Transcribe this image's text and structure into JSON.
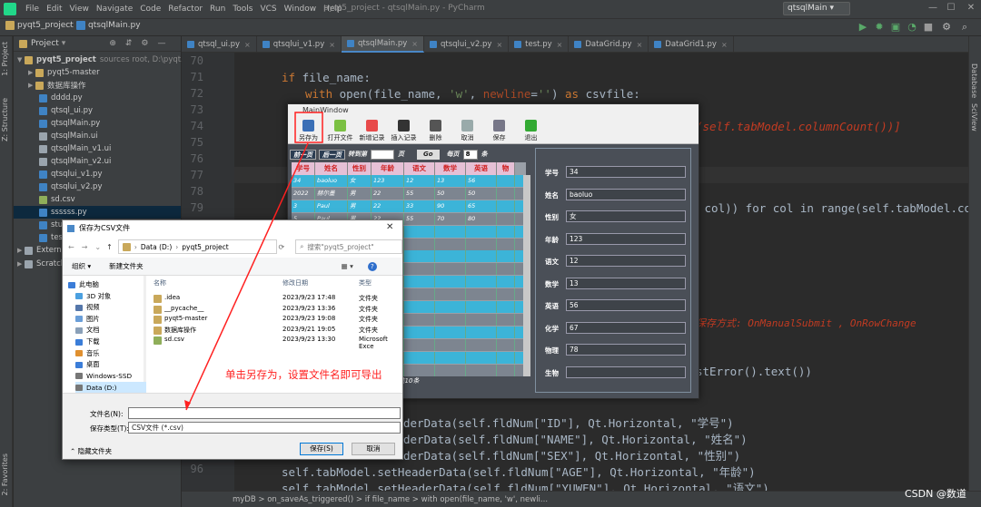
{
  "menu": {
    "project_name": "pyqt5_project",
    "file_name": "qtsqlMain.py",
    "items": [
      "File",
      "Edit",
      "View",
      "Navigate",
      "Code",
      "Refactor",
      "Run",
      "Tools",
      "VCS",
      "Window",
      "Help"
    ],
    "title": "pyqt5_project - qtsqlMain.py - PyCharm"
  },
  "toolbar": {
    "run_config": "qtsqlMain"
  },
  "left_strip": {
    "project": "1: Project",
    "structure": "Z: Structure",
    "favorites": "2: Favorites"
  },
  "right_strip": {
    "database": "Database",
    "sciview": "SciView"
  },
  "project_pane": {
    "header": "Project",
    "root": "pyqt5_project",
    "root_hint": "sources root, D:\\pyqt5_p",
    "items": [
      {
        "label": "pyqt5-master",
        "type": "folder"
      },
      {
        "label": "数据库操作",
        "type": "folder"
      },
      {
        "label": "dddd.py",
        "type": "py"
      },
      {
        "label": "qtsql_ui.py",
        "type": "py"
      },
      {
        "label": "qtsqlMain.py",
        "type": "py"
      },
      {
        "label": "qtsqlMain.ui",
        "type": "ui"
      },
      {
        "label": "qtsqlMain_v1.ui",
        "type": "ui"
      },
      {
        "label": "qtsqlMain_v2.ui",
        "type": "ui"
      },
      {
        "label": "qtsqlui_v1.py",
        "type": "py"
      },
      {
        "label": "qtsqlui_v2.py",
        "type": "py"
      },
      {
        "label": "sd.csv",
        "type": "csv"
      },
      {
        "label": "ssssss.py",
        "type": "py"
      },
      {
        "label": "stu",
        "type": "py"
      },
      {
        "label": "test",
        "type": "py"
      }
    ],
    "external": "Externa",
    "scratches": "Scratch"
  },
  "tabs": [
    "qtsql_ui.py",
    "qtsqlui_v1.py",
    "qtsqlMain.py",
    "qtsqlui_v2.py",
    "test.py",
    "DataGrid.py",
    "DataGrid1.py"
  ],
  "code": {
    "line_numbers": [
      "70",
      "71",
      "72",
      "73",
      "74",
      "75",
      "76",
      "77",
      "78",
      "79",
      "",
      "",
      "",
      "",
      "",
      "",
      "",
      "",
      "",
      "",
      "",
      "",
      "",
      "",
      "95",
      "96"
    ],
    "l71_a": "if",
    "l71_b": " file_name:",
    "l72_a": "with",
    "l72_b": " open(file_name, ",
    "l72_c": "'w'",
    "l72_d": ", ",
    "l72_e": "newline",
    "l72_f": "=",
    "l72_g": "''",
    "l72_h": ") ",
    "l72_i": "as",
    "l72_j": " csvfile:",
    "l74_frag": "(self.tabModel.columnCount())]",
    "l79_frag": " col)) for col in range(self.tabModel.columnc",
    "comment_frag": "保存方式: OnManualSubmit , OnRowChange",
    "err_frag": "stError().text())",
    "h1": "derData(self.fldNum[\"ID\"], Qt.Horizontal, \"学号\")",
    "h2": "derData(self.fldNum[\"NAME\"], Qt.Horizontal, \"姓名\")",
    "h3": "derData(self.fldNum[\"SEX\"], Qt.Horizontal, \"性别\")",
    "l95": "self.tabModel.setHeaderData(self.fldNum[\"AGE\"], Qt.Horizontal, \"年龄\")",
    "l96": "self.tabModel.setHeaderData(self.fldNum[\"YUWEN\"], Qt.Horizontal, \"语文\")"
  },
  "status": {
    "breadcrumb": "myDB  >  on_saveAs_triggered()  >  if file_name  >  with open(file_name, 'w', newli..."
  },
  "qt": {
    "title": "MainWindow",
    "toolbar": [
      "另存为",
      "打开文件",
      "新增记录",
      "插入记录",
      "删除",
      "取消",
      "保存",
      "退出"
    ],
    "pager": {
      "first": "前一页",
      "next": "后一页",
      "goto": "转到第",
      "page": "页",
      "go": "Go",
      "per_page": "每页",
      "per_val": "8",
      "unit": "条"
    },
    "headers": [
      "学号",
      "姓名",
      "性别",
      "年龄",
      "语文",
      "数学",
      "英语",
      "物"
    ],
    "rows": [
      [
        "34",
        "baoluo",
        "女",
        "123",
        "12",
        "13",
        "56",
        ""
      ],
      [
        "2022",
        "赫尔墨",
        "男",
        "22",
        "55",
        "50",
        "50",
        ""
      ],
      [
        "3",
        "Paul",
        "男",
        "22",
        "33",
        "90",
        "65",
        ""
      ],
      [
        "5",
        "Paul",
        "男",
        "22",
        "55",
        "70",
        "80",
        ""
      ]
    ],
    "footer": "共10条",
    "form": {
      "labels": [
        "学号",
        "姓名",
        "性别",
        "年龄",
        "语文",
        "数学",
        "英语",
        "化学",
        "物理",
        "生物"
      ],
      "values": [
        "34",
        "baoluo",
        "女",
        "123",
        "12",
        "13",
        "56",
        "67",
        "78",
        ""
      ]
    }
  },
  "dialog": {
    "title": "保存为CSV文件",
    "path": [
      "Data (D:)",
      "pyqt5_project"
    ],
    "search_placeholder": "搜索\"pyqt5_project\"",
    "organize": "组织 ▾",
    "new_folder": "新建文件夹",
    "nav": [
      "此电脑",
      "3D 对象",
      "视频",
      "图片",
      "文档",
      "下载",
      "音乐",
      "桌面",
      "Windows-SSD",
      "Data (D:)"
    ],
    "col_name": "名称",
    "col_date": "修改日期",
    "col_type": "类型",
    "files": [
      {
        "name": ".idea",
        "date": "2023/9/23 17:48",
        "type": "文件夹"
      },
      {
        "name": "__pycache__",
        "date": "2023/9/23 13:36",
        "type": "文件夹"
      },
      {
        "name": "pyqt5-master",
        "date": "2023/9/23 19:08",
        "type": "文件夹"
      },
      {
        "name": "数据库操作",
        "date": "2023/9/21 19:05",
        "type": "文件夹"
      },
      {
        "name": "sd.csv",
        "date": "2023/9/23 13:30",
        "type": "Microsoft Exce"
      }
    ],
    "filename_label": "文件名(N):",
    "filename_value": "",
    "filetype_label": "保存类型(T):",
    "filetype_value": "CSV文件 (*.csv)",
    "hide_folders": "隐藏文件夹",
    "save": "保存(S)",
    "cancel": "取消"
  },
  "annotation": "单击另存为，设置文件名即可导出",
  "watermark": "CSDN @数道",
  "colors": {
    "accent": "#4a88c7",
    "annotation": "#ff2020",
    "grid_cell": "#3cb4d8"
  }
}
